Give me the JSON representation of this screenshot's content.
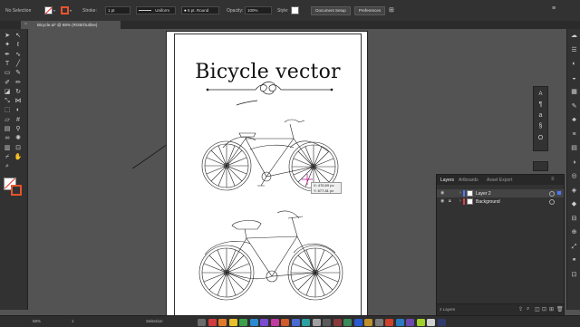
{
  "control_bar": {
    "selection": "No Selection",
    "stroke_label": "Stroke:",
    "stroke_weight": "1 pt",
    "stroke_profile": "Uniform",
    "brush": "5 pt. Round",
    "opacity_label": "Opacity:",
    "opacity_value": "100%",
    "style_label": "Style:",
    "document_setup": "Document Setup",
    "preferences": "Preferences"
  },
  "document": {
    "tab_title": "Bicycle.ai* @ 68% (RGB/Outline)",
    "close_glyph": "×"
  },
  "artboard": {
    "title": "Bicycle vector"
  },
  "cursor_tooltip": {
    "x": "X: 476.69 px",
    "y": "Y: 677.81 px"
  },
  "layers_panel": {
    "tabs": [
      "Layers",
      "Artboards",
      "Asset Export"
    ],
    "active_tab": "Layers",
    "layers": [
      {
        "name": "Layer 2",
        "color": "#4a7bff",
        "selected": true
      },
      {
        "name": "Background",
        "color": "#e0404a",
        "selected": false
      }
    ],
    "count_label": "2 Layers"
  },
  "status_bar": {
    "zoom": "68%",
    "page": "1",
    "tool": "Selection"
  },
  "colors": {
    "ui_dark": "#323232",
    "canvas": "#535353",
    "fill_swatch": "#ffffff",
    "stroke_swatch": "#e8532b",
    "none_slash": "#e8302b"
  },
  "tools": [
    "selection-tool",
    "direct-selection-tool",
    "magic-wand-tool",
    "lasso-tool",
    "pen-tool",
    "curvature-tool",
    "type-tool",
    "line-tool",
    "rectangle-tool",
    "paintbrush-tool",
    "shaper-tool",
    "pencil-tool",
    "eraser-tool",
    "rotate-tool",
    "scale-tool",
    "width-tool",
    "free-transform-tool",
    "shape-builder-tool",
    "perspective-tool",
    "mesh-tool",
    "gradient-tool",
    "eyedropper-tool",
    "blend-tool",
    "symbol-sprayer-tool",
    "graph-tool",
    "artboard-tool",
    "slice-tool",
    "hand-tool",
    "zoom-tool"
  ]
}
